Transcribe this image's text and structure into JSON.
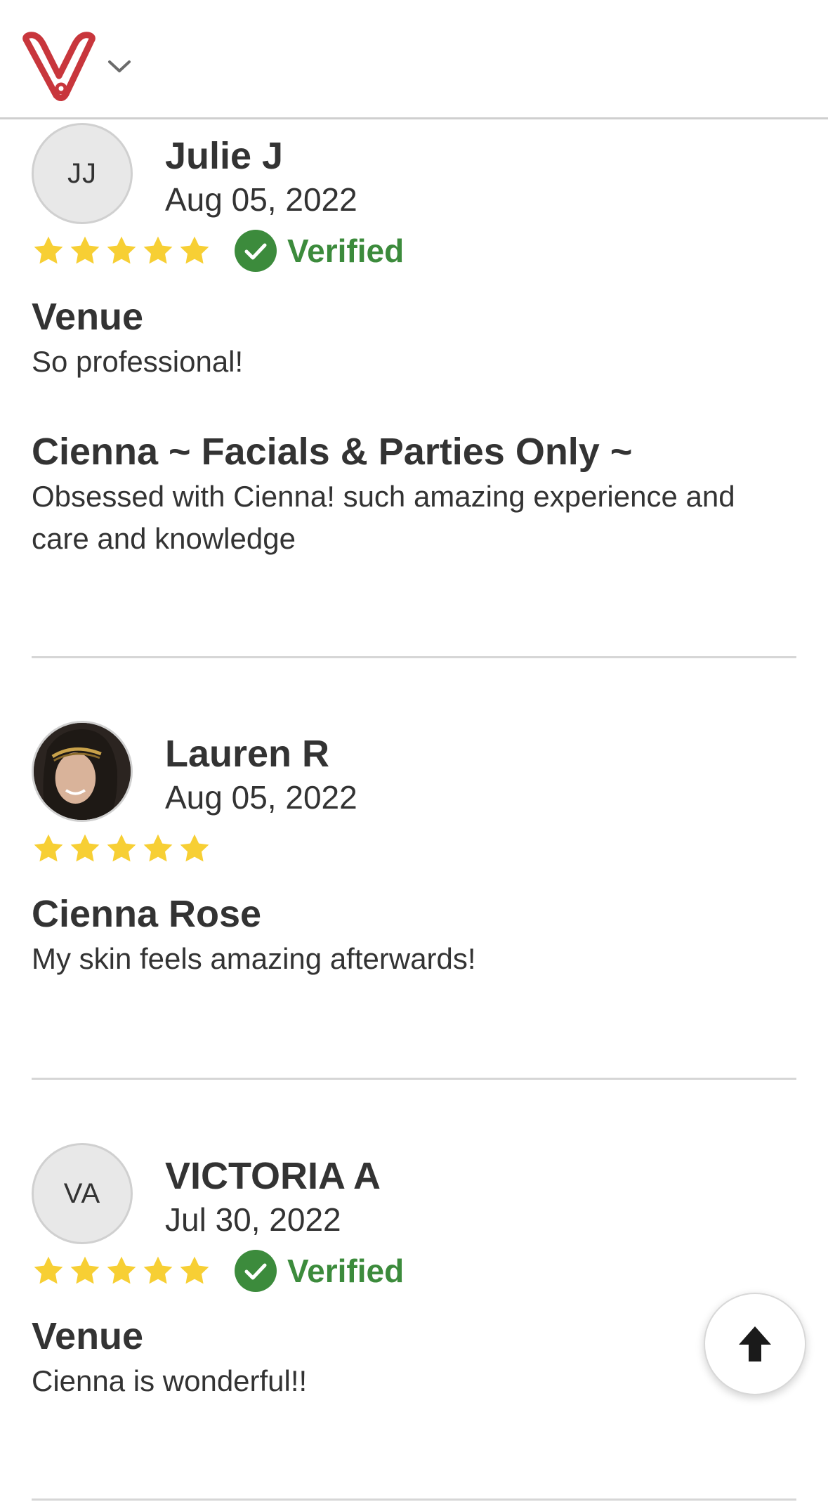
{
  "header": {
    "logo_icon": "wedding-wire-v-logo",
    "menu_icon": "chevron-down-icon"
  },
  "colors": {
    "brand_red": "#c8363c",
    "star_yellow": "#f7cf34",
    "verified_green": "#3c8b3c"
  },
  "reviews": [
    {
      "initials": "JJ",
      "name": "Julie J",
      "date": "Aug 05, 2022",
      "rating": 5,
      "verified": true,
      "verified_label": "Verified",
      "sections": [
        {
          "title": "Venue",
          "text": "So professional!"
        },
        {
          "title": "Cienna ~ Facials & Parties Only ~",
          "text": "Obsessed with Cienna! such amazing experience and care and knowledge"
        }
      ]
    },
    {
      "initials": "",
      "avatar_icon": "user-photo",
      "name": "Lauren R",
      "date": "Aug 05, 2022",
      "rating": 5,
      "verified": false,
      "sections": [
        {
          "title": "Cienna Rose",
          "text": "My skin feels amazing afterwards!"
        }
      ]
    },
    {
      "initials": "VA",
      "name": "VICTORIA A",
      "date": "Jul 30, 2022",
      "rating": 5,
      "verified": true,
      "verified_label": "Verified",
      "sections": [
        {
          "title": "Venue",
          "text": "Cienna is wonderful!!"
        }
      ]
    }
  ],
  "scroll_top_icon": "arrow-up-icon"
}
